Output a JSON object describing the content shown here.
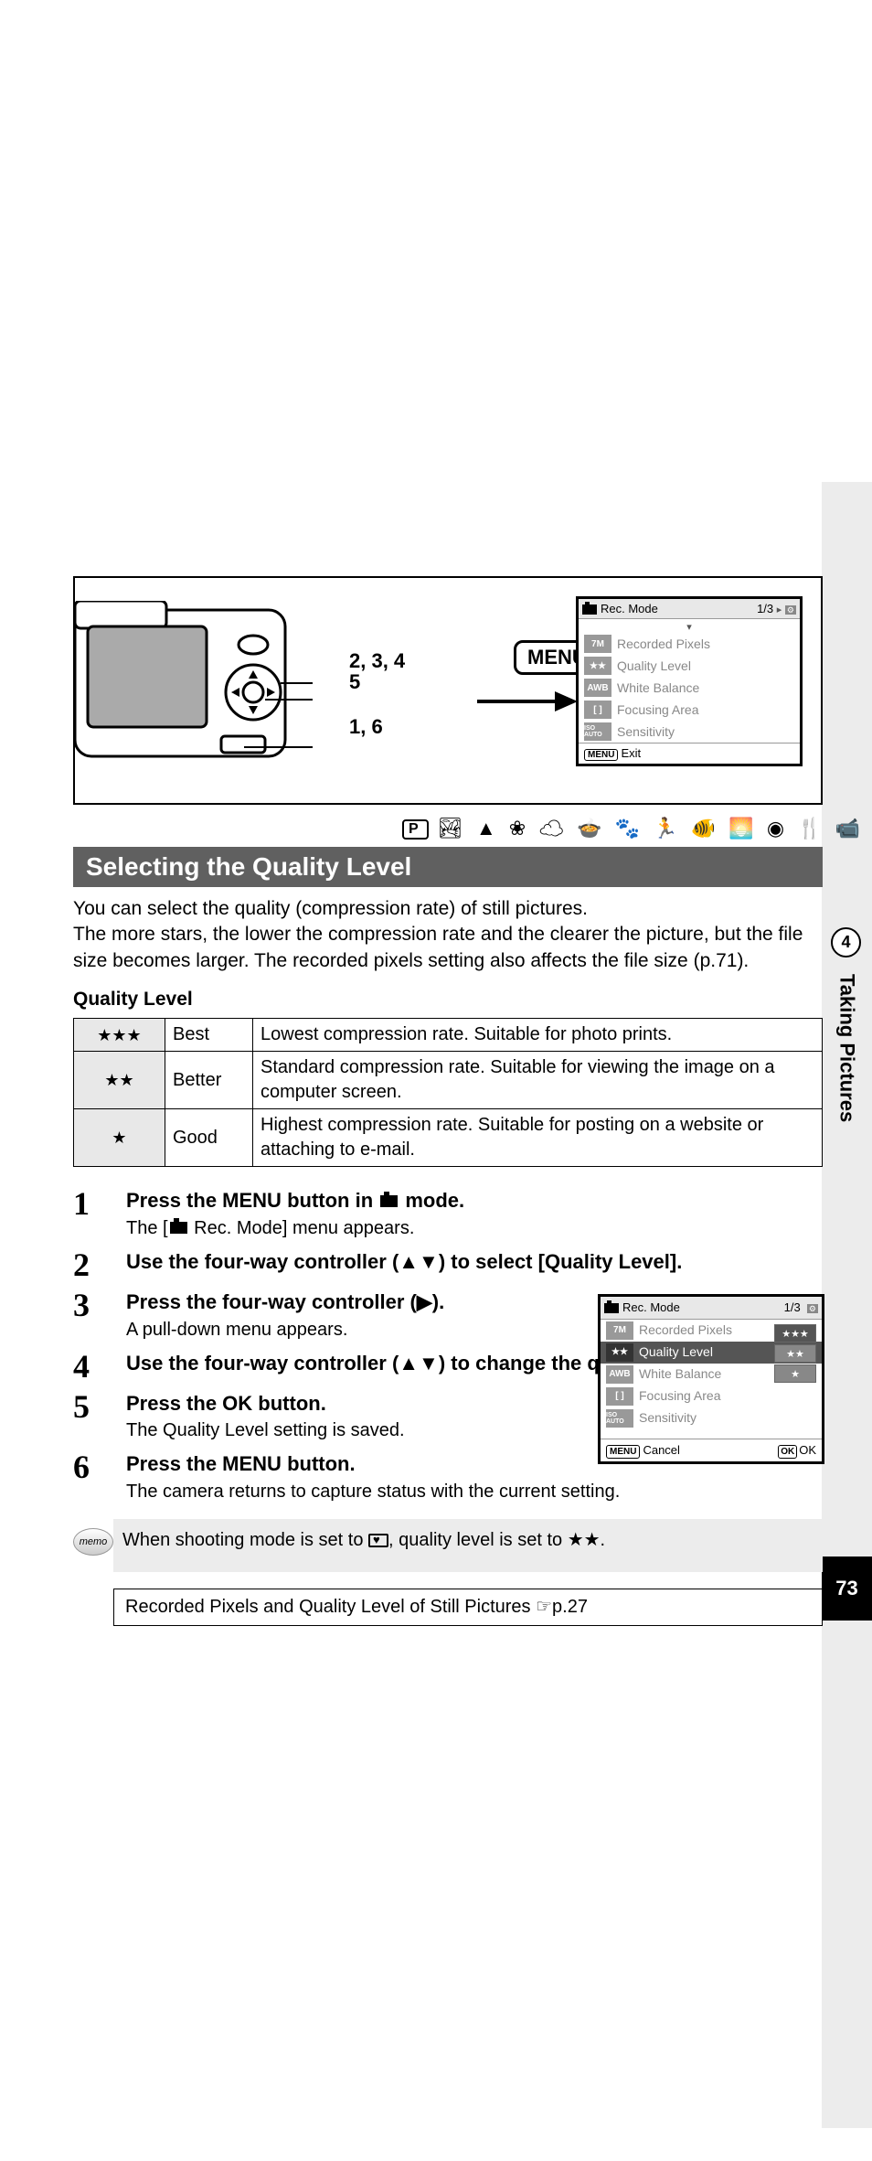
{
  "chapter": {
    "number": "4",
    "title": "Taking Pictures"
  },
  "page_number": "73",
  "diagram": {
    "menu_button_label": "MENU",
    "callouts": {
      "a": "2, 3, 4",
      "b": "5",
      "c": "1, 6"
    },
    "lcd1": {
      "title": "Rec. Mode",
      "page": "1/3",
      "rows": [
        {
          "tag": "7M",
          "label": "Recorded Pixels"
        },
        {
          "tag": "★★",
          "label": "Quality Level"
        },
        {
          "tag": "AWB",
          "label": "White Balance"
        },
        {
          "tag": "[ ]",
          "label": "Focusing Area"
        },
        {
          "tag": "ISO AUTO",
          "label": "Sensitivity"
        }
      ],
      "footer_left": "Exit"
    }
  },
  "mode_icons_row": "R  q  <  I  \\  i  c  Q  E  D  Y",
  "heading": "Selecting the Quality Level",
  "intro": "You can select the quality (compression rate) of still pictures.\nThe more stars, the lower the compression rate and the clearer the picture, but the file size becomes larger. The recorded pixels setting also affects the file size (p.71).",
  "quality_label": "Quality Level",
  "quality_table": [
    {
      "stars": "★★★",
      "name": "Best",
      "desc": "Lowest compression rate. Suitable for photo prints."
    },
    {
      "stars": "★★",
      "name": "Better",
      "desc": "Standard compression rate. Suitable for viewing the image on a computer screen."
    },
    {
      "stars": "★",
      "name": "Good",
      "desc": "Highest compression rate. Suitable for posting on a website or attaching to e-mail."
    }
  ],
  "steps": [
    {
      "n": "1",
      "title_pre": "Press the ",
      "title_strong": "MENU",
      "title_mid": " button in ",
      "title_post": " mode.",
      "sub_pre": "The [",
      "sub_post": " Rec. Mode] menu appears."
    },
    {
      "n": "2",
      "title": "Use the four-way controller (▲▼) to select [Quality Level]."
    },
    {
      "n": "3",
      "title": "Press the four-way controller (▶).",
      "sub": "A pull-down menu appears."
    },
    {
      "n": "4",
      "title": "Use the four-way controller (▲▼) to change the quality level."
    },
    {
      "n": "5",
      "title_pre": "Press the ",
      "title_strong": "OK",
      "title_post": " button.",
      "sub": "The Quality Level setting is saved."
    },
    {
      "n": "6",
      "title_pre": "Press the ",
      "title_strong": "MENU",
      "title_post": " button.",
      "sub": "The camera returns to capture status with the current setting."
    }
  ],
  "lcd2": {
    "title": "Rec. Mode",
    "page": "1/3",
    "rows": [
      {
        "tag": "7M",
        "label": "Recorded Pixels"
      },
      {
        "tag": "★★",
        "label": "Quality Level",
        "selected": true
      },
      {
        "tag": "AWB",
        "label": "White Balance"
      },
      {
        "tag": "[ ]",
        "label": "Focusing Area"
      },
      {
        "tag": "ISO AUTO",
        "label": "Sensitivity"
      }
    ],
    "options": [
      "★★★",
      "★★",
      "★"
    ],
    "footer_left": "Cancel",
    "footer_right": "OK"
  },
  "memo": {
    "badge": "memo",
    "text_pre": "When shooting mode is set to ",
    "text_post": ", quality level is set to ★★."
  },
  "xref": "Recorded Pixels and Quality Level of Still Pictures ☞p.27"
}
